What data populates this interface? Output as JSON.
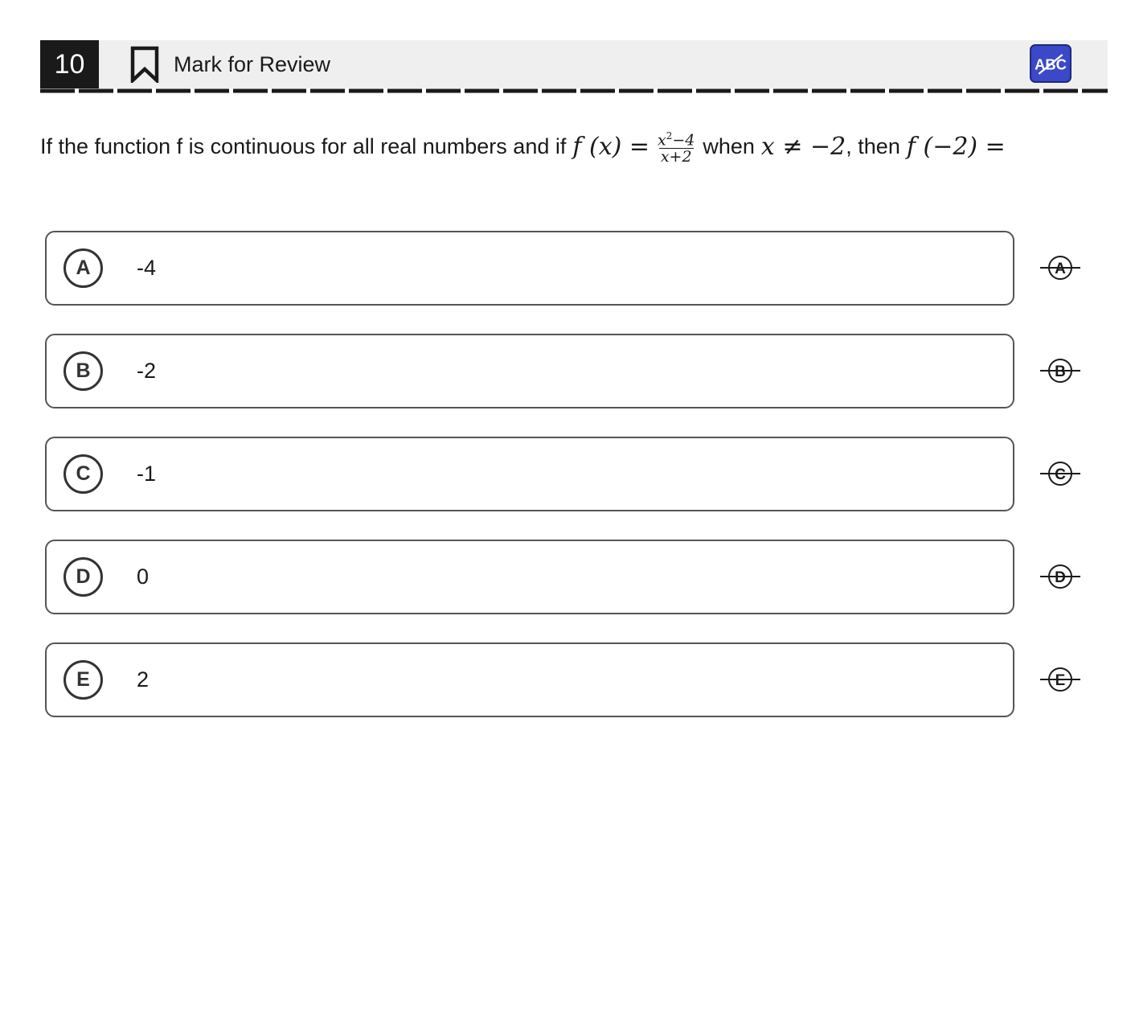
{
  "header": {
    "question_number": "10",
    "mark_for_review_label": "Mark for Review",
    "bookmark_icon": "bookmark-outline-icon",
    "abc_button_label": "ABC",
    "abc_button_icon": "abc-strikethrough-icon",
    "abc_button_color": "#3b48c8"
  },
  "question": {
    "text_before": "If the function f is continuous for all real numbers and if",
    "func_lhs": "f (x) =",
    "fraction_numerator_base": "x",
    "fraction_numerator_exponent": "2",
    "fraction_numerator_tail": "−4",
    "fraction_denominator": "x+2",
    "text_when": "when",
    "condition": "x ≠ −2",
    "text_then": ", then",
    "func_query": "f (−2) ="
  },
  "options": [
    {
      "letter": "A",
      "value": "-4"
    },
    {
      "letter": "B",
      "value": "-2"
    },
    {
      "letter": "C",
      "value": "-1"
    },
    {
      "letter": "D",
      "value": "0"
    },
    {
      "letter": "E",
      "value": "2"
    }
  ]
}
